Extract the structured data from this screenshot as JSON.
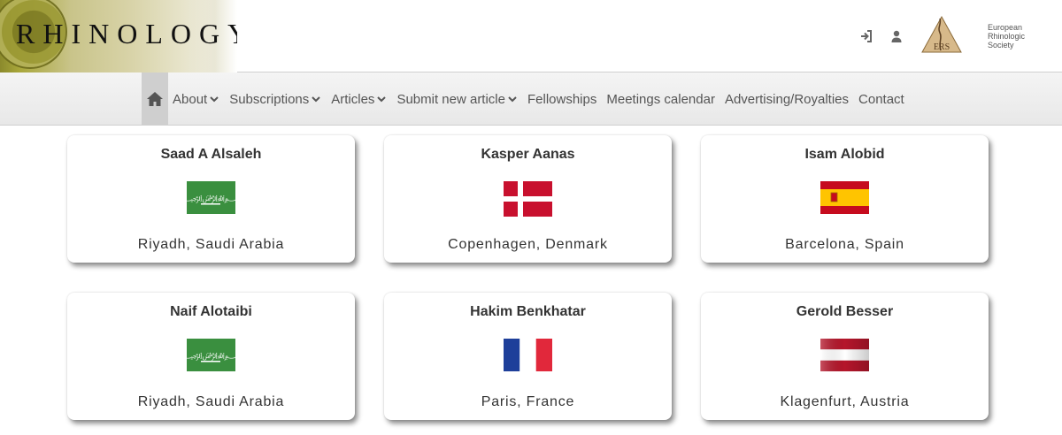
{
  "header": {
    "logo_text": "RHINOLOGY",
    "ers_text": [
      "European",
      "Rhinologic",
      "Society"
    ],
    "ers_badge": "ERS",
    "icons": [
      "login-icon",
      "user-icon"
    ]
  },
  "nav": {
    "home_icon": "home-icon",
    "items": [
      {
        "label": "About",
        "dropdown": true
      },
      {
        "label": "Subscriptions",
        "dropdown": true
      },
      {
        "label": "Articles",
        "dropdown": true
      },
      {
        "label": "Submit new article",
        "dropdown": true
      },
      {
        "label": "Fellowships",
        "dropdown": false
      },
      {
        "label": "Meetings calendar",
        "dropdown": false
      },
      {
        "label": "Advertising/Royalties",
        "dropdown": false
      },
      {
        "label": "Contact",
        "dropdown": false
      }
    ]
  },
  "cards": [
    {
      "name": "Saad A Alsaleh",
      "flag": "saudi-arabia",
      "location": "Riyadh, Saudi Arabia"
    },
    {
      "name": "Kasper Aanas",
      "flag": "denmark",
      "location": "Copenhagen, Denmark"
    },
    {
      "name": "Isam Alobid",
      "flag": "spain",
      "location": "Barcelona, Spain"
    },
    {
      "name": "Naif Alotaibi",
      "flag": "saudi-arabia",
      "location": "Riyadh, Saudi Arabia"
    },
    {
      "name": "Hakim Benkhatar",
      "flag": "france",
      "location": "Paris, France"
    },
    {
      "name": "Gerold Besser",
      "flag": "austria",
      "location": "Klagenfurt, Austria"
    }
  ],
  "colors": {
    "saudi_green": "#3a8f3f",
    "denmark_red": "#c8102e",
    "spain_red": "#c60b1e",
    "spain_yellow": "#ffc400",
    "france_blue": "#1e3f9a",
    "france_red": "#e1283b",
    "austria_red": "#b5162b"
  }
}
